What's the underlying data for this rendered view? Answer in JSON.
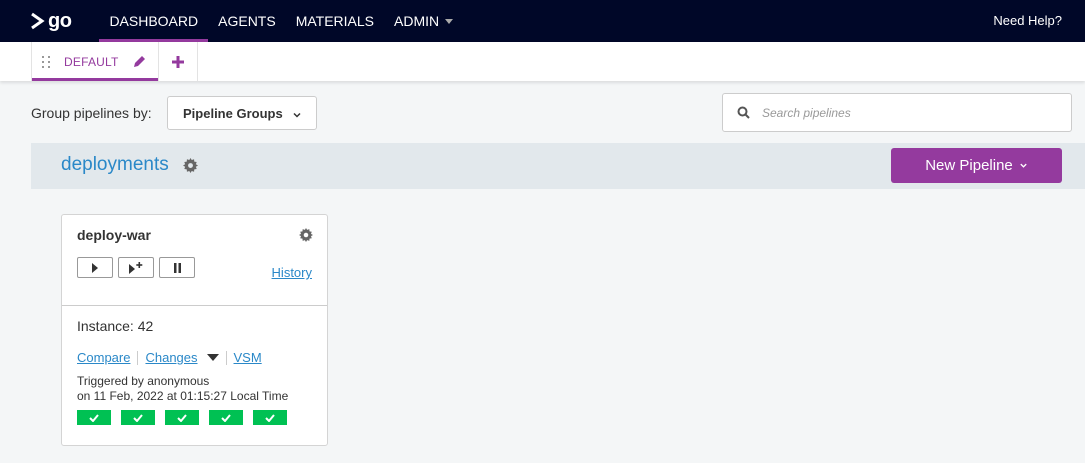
{
  "nav": {
    "logo_text": "go",
    "items": [
      {
        "label": "DASHBOARD",
        "active": true
      },
      {
        "label": "AGENTS",
        "active": false
      },
      {
        "label": "MATERIALS",
        "active": false
      },
      {
        "label": "ADMIN",
        "active": false,
        "has_dropdown": true
      }
    ],
    "help": "Need Help?"
  },
  "tabs": {
    "current": "DEFAULT"
  },
  "controls": {
    "group_by_label": "Group pipelines by:",
    "group_by_value": "Pipeline Groups",
    "search_placeholder": "Search pipelines"
  },
  "group": {
    "name": "deployments",
    "new_pipeline_label": "New Pipeline"
  },
  "pipeline": {
    "name": "deploy-war",
    "history_label": "History",
    "instance_label": "Instance: 42",
    "compare_label": "Compare",
    "changes_label": "Changes",
    "vsm_label": "VSM",
    "triggered_by": "Triggered by anonymous",
    "triggered_on": "on 11 Feb, 2022 at 01:15:27 Local Time",
    "stages": [
      {
        "status": "passed"
      },
      {
        "status": "passed"
      },
      {
        "status": "passed"
      },
      {
        "status": "passed"
      },
      {
        "status": "passed"
      }
    ]
  },
  "colors": {
    "nav_bg": "#000728",
    "accent": "#943a9e",
    "link": "#2a88c8",
    "stage_passed": "#00c153",
    "group_header_bg": "#e2e8ec"
  }
}
